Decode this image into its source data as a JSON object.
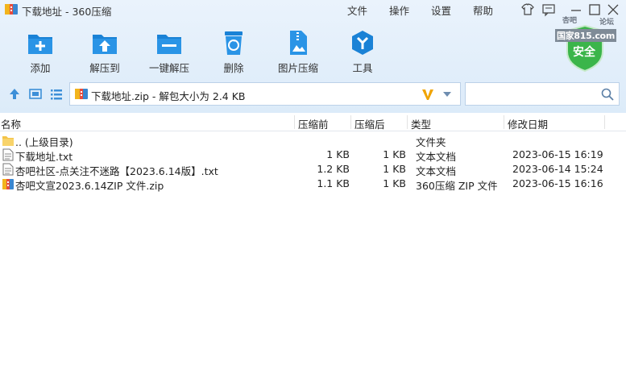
{
  "window": {
    "title": "下载地址 - 360压缩"
  },
  "menu": {
    "file": "文件",
    "operation": "操作",
    "settings": "设置",
    "help": "帮助"
  },
  "toolbar": {
    "add": "添加",
    "extract_to": "解压到",
    "one_click_extract": "一键解压",
    "delete": "删除",
    "image_compress": "图片压缩",
    "tools": "工具"
  },
  "badge": {
    "site_top": "杏吧",
    "site_top2": "论坛",
    "site_mid": "国家815.com",
    "safe": "安全"
  },
  "address": {
    "text": "下载地址.zip - 解包大小为 2.4 KB"
  },
  "search": {
    "placeholder": ""
  },
  "columns": {
    "name": "名称",
    "before": "压缩前",
    "after": "压缩后",
    "type": "类型",
    "modified": "修改日期"
  },
  "files": [
    {
      "name": ".. (上级目录)",
      "before": "",
      "after": "",
      "type": "文件夹",
      "modified": "",
      "icon": "folder-icon"
    },
    {
      "name": "下载地址.txt",
      "before": "1 KB",
      "after": "1 KB",
      "type": "文本文档",
      "modified": "2023-06-15 16:19",
      "icon": "text-file-icon"
    },
    {
      "name": "杏吧社区-点关注不迷路【2023.6.14版】.txt",
      "before": "1.2 KB",
      "after": "1 KB",
      "type": "文本文档",
      "modified": "2023-06-14 15:24",
      "icon": "text-file-icon"
    },
    {
      "name": "杏吧文宣2023.6.14ZIP 文件.zip",
      "before": "1.1 KB",
      "after": "1 KB",
      "type": "360压缩 ZIP 文件",
      "modified": "2023-06-15 16:16",
      "icon": "zip-file-icon"
    }
  ],
  "colors": {
    "accent": "#1a82d6",
    "top_bg": "#e2eefa",
    "v_badge": "#f0a400",
    "safe_green": "#3bb54a"
  }
}
